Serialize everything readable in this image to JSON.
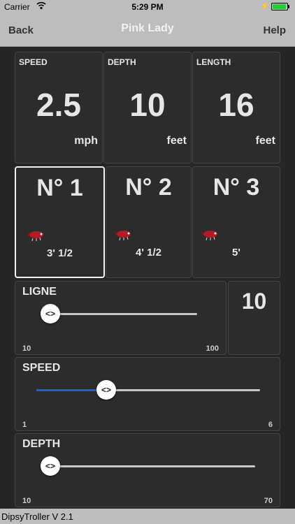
{
  "status_bar": {
    "carrier": "Carrier",
    "time": "5:29 PM",
    "battery_color": "#2ec93a"
  },
  "nav": {
    "back_label": "Back",
    "title": "Pink Lady",
    "help_label": "Help"
  },
  "stats": [
    {
      "label": "SPEED",
      "value": "2.5",
      "unit": "mph"
    },
    {
      "label": "DEPTH",
      "value": "10",
      "unit": "feet"
    },
    {
      "label": "LENGTH",
      "value": "16",
      "unit": "feet"
    }
  ],
  "rods": [
    {
      "title": "N° 1",
      "measure": "3' 1/2",
      "selected": true,
      "icon": "lure-icon"
    },
    {
      "title": "N° 2",
      "measure": "4' 1/2",
      "selected": false,
      "icon": "lure-icon"
    },
    {
      "title": "N° 3",
      "measure": "5'",
      "selected": false,
      "icon": "lure-icon"
    }
  ],
  "ligne": {
    "label": "LIGNE",
    "min": "10",
    "max": "100",
    "value": 10,
    "value_display": "10"
  },
  "speed_slider": {
    "label": "SPEED",
    "min": "1",
    "max": "6",
    "value": 2.5
  },
  "depth_slider": {
    "label": "DEPTH",
    "min": "10",
    "max": "70",
    "value": 10
  },
  "thumb_glyph": "<>",
  "colors": {
    "accent": "#1d5fd6",
    "bars": "#bdbdbd",
    "background": "#262626",
    "lure": "#b51b22"
  },
  "footer": {
    "version": "DipsyTroller V 2.1"
  }
}
